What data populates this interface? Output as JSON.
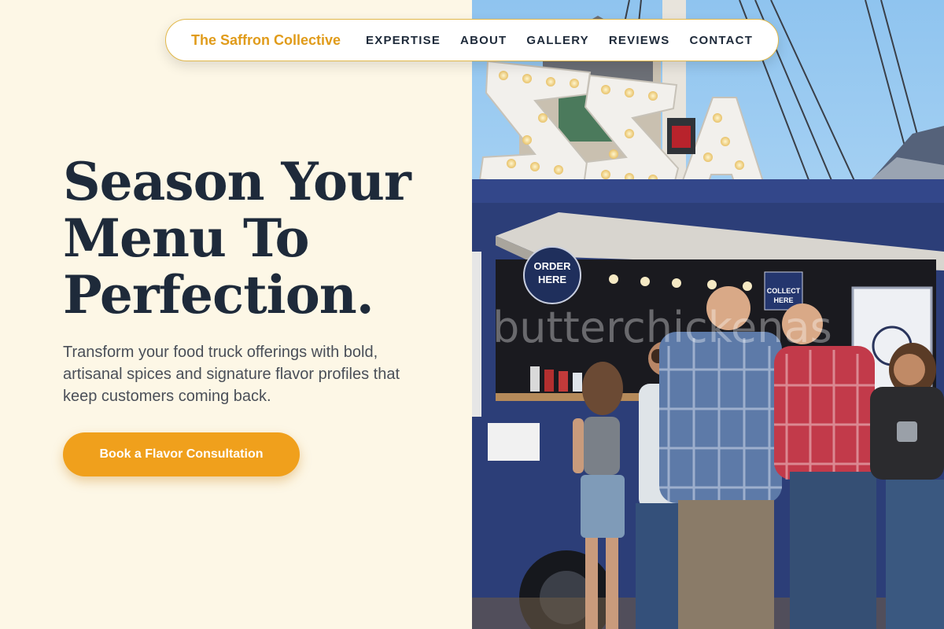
{
  "nav": {
    "brand": "The Saffron Collective",
    "links": [
      "EXPERTISE",
      "ABOUT",
      "GALLERY",
      "REVIEWS",
      "CONTACT"
    ]
  },
  "hero": {
    "headline_lines": [
      "Season Your",
      "Menu To",
      "Perfection."
    ],
    "subtitle": "Transform your food truck offerings with bold, artisanal spices and signature flavor profiles that keep customers coming back.",
    "cta_label": "Book a Flavor Consultation"
  },
  "photo": {
    "sign_text": "ZZA",
    "order_sign": [
      "ORDER",
      "HERE"
    ],
    "collect_sign": [
      "COLLECT",
      "HERE"
    ],
    "watermark": "butterchickenas"
  },
  "colors": {
    "background": "#fdf7e6",
    "accent": "#f0a01c",
    "brand": "#e09b1a",
    "text": "#1e2a3a",
    "truck_blue": "#2c3e78"
  }
}
